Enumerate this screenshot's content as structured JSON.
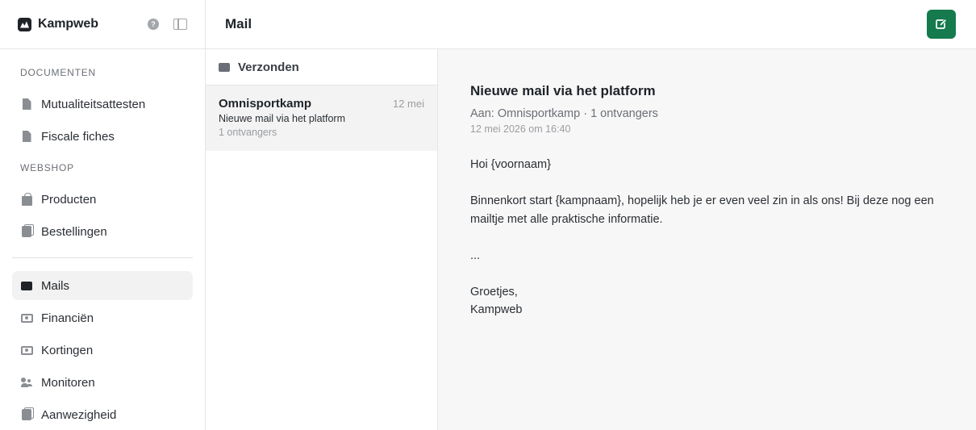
{
  "app": {
    "name": "Kampweb"
  },
  "header": {
    "title": "Mail"
  },
  "sidebar": {
    "sections": [
      {
        "label": "DOCUMENTEN",
        "items": [
          {
            "label": "Mutualiteitsattesten",
            "icon": "document-icon"
          },
          {
            "label": "Fiscale fiches",
            "icon": "document-icon"
          }
        ]
      },
      {
        "label": "WEBSHOP",
        "items": [
          {
            "label": "Producten",
            "icon": "shopping-bag-icon"
          },
          {
            "label": "Bestellingen",
            "icon": "orders-icon"
          }
        ]
      }
    ],
    "items": [
      {
        "label": "Mails",
        "icon": "mail-icon",
        "active": true
      },
      {
        "label": "Financiën",
        "icon": "money-icon"
      },
      {
        "label": "Kortingen",
        "icon": "money-icon"
      },
      {
        "label": "Monitoren",
        "icon": "people-icon"
      },
      {
        "label": "Aanwezigheid",
        "icon": "orders-icon"
      }
    ]
  },
  "mail_list": {
    "folder": "Verzonden",
    "items": [
      {
        "sender": "Omnisportkamp",
        "date": "12 mei",
        "subject": "Nieuwe mail via het platform",
        "recipients": "1 ontvangers"
      }
    ]
  },
  "reader": {
    "subject": "Nieuwe mail via het platform",
    "meta": "Aan: Omnisportkamp · 1 ontvangers",
    "datetime": "12 mei 2026 om 16:40",
    "body": [
      "Hoi {voornaam}",
      "",
      "Binnenkort start {kampnaam}, hopelijk heb je er even veel zin in als ons! Bij deze nog een mailtje met alle praktische informatie.",
      "",
      "...",
      "",
      "Groetjes,",
      "Kampweb"
    ]
  },
  "colors": {
    "accent": "#157a4d",
    "active_bg": "#f2f2f2",
    "reader_bg": "#f7f7f7"
  }
}
